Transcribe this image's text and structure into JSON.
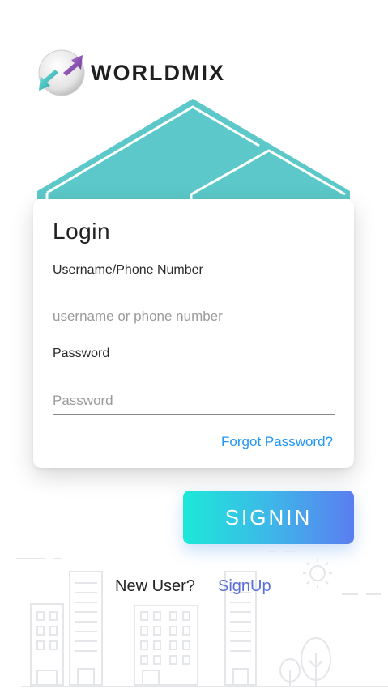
{
  "brand": {
    "name": "WORLDMIX",
    "icon": "globe-arrows-icon"
  },
  "login": {
    "title": "Login",
    "username_label": "Username/Phone Number",
    "username_placeholder": "username or phone number",
    "password_label": "Password",
    "password_placeholder": "Password",
    "forgot_label": "Forgot Password?"
  },
  "signin_label": "SIGNIN",
  "footer": {
    "prompt": "New User?",
    "signup_label": "SignUp"
  },
  "colors": {
    "roof": "#5cc8c9",
    "link": "#2196f3",
    "signup_link": "#5b6fd9",
    "button_gradient_start": "#1ce8d8",
    "button_gradient_end": "#5b7ef0",
    "city_lines": "#e4e6ea"
  }
}
